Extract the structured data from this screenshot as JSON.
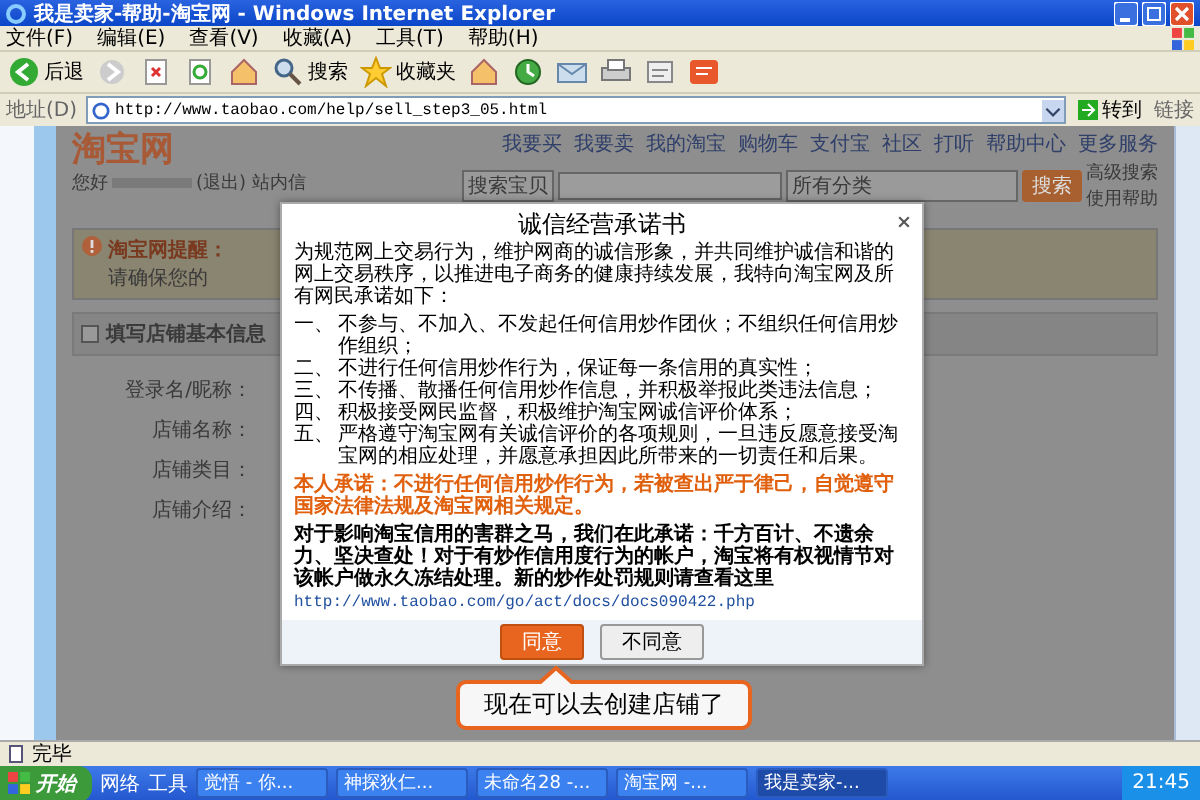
{
  "window": {
    "title": "我是卖家-帮助-淘宝网 - Windows Internet Explorer"
  },
  "menu": [
    "文件(F)",
    "编辑(E)",
    "查看(V)",
    "收藏(A)",
    "工具(T)",
    "帮助(H)"
  ],
  "toolbar": [
    {
      "kind": "back",
      "label": "后退"
    },
    {
      "kind": "forward"
    },
    {
      "kind": "stop"
    },
    {
      "kind": "refresh"
    },
    {
      "kind": "home"
    },
    {
      "kind": "search",
      "label": "搜索"
    },
    {
      "kind": "favorites",
      "label": "收藏夹"
    },
    {
      "kind": "home"
    },
    {
      "kind": "history"
    },
    {
      "kind": "mail"
    },
    {
      "kind": "print"
    },
    {
      "kind": "edit"
    },
    {
      "kind": "blog"
    }
  ],
  "address": {
    "label": "地址(D)",
    "url": "http://www.taobao.com/help/sell_step3_05.html",
    "go": "转到",
    "links": "链接"
  },
  "page": {
    "logo": "淘宝网",
    "greeting_prefix": "您好",
    "greeting_suffix": "(退出) 站内信",
    "nav": [
      "我要买",
      "我要卖",
      "我的淘宝",
      "购物车",
      "支付宝",
      "社区",
      "打听",
      "帮助中心",
      "更多服务"
    ],
    "search": {
      "category": "搜索宝贝",
      "scope": "所有分类",
      "button": "搜索",
      "links": [
        "高级搜索",
        "使用帮助"
      ]
    },
    "notice": {
      "label": "淘宝网提醒：",
      "text": "请确保您的"
    },
    "section_title": "填写店铺基本信息",
    "form_labels": [
      "登录名/昵称：",
      "店铺名称：",
      "店铺类目：",
      "店铺介绍："
    ]
  },
  "dialog": {
    "title": "诚信经营承诺书",
    "intro": "为规范网上交易行为，维护网商的诚信形象，并共同维护诚信和谐的网上交易秩序，以推进电子商务的健康持续发展，我特向淘宝网及所有网民承诺如下：",
    "items": [
      {
        "marker": "一、",
        "text": "不参与、不加入、不发起任何信用炒作团伙；不组织任何信用炒作组织；"
      },
      {
        "marker": "二、",
        "text": "不进行任何信用炒作行为，保证每一条信用的真实性；"
      },
      {
        "marker": "三、",
        "text": "不传播、散播任何信用炒作信息，并积极举报此类违法信息；"
      },
      {
        "marker": "四、",
        "text": "积极接受网民监督，积极维护淘宝网诚信评价体系；"
      },
      {
        "marker": "五、",
        "text": "严格遵守淘宝网有关诚信评价的各项规则，一旦违反愿意接受淘宝网的相应处理，并愿意承担因此所带来的一切责任和后果。"
      }
    ],
    "pledge": "本人承诺：不进行任何信用炒作行为，若被查出严于律己，自觉遵守国家法律法规及淘宝网相关规定。",
    "warning": "对于影响淘宝信用的害群之马，我们在此承诺：千方百计、不遗余力、坚决查处！对于有炒作信用度行为的帐户，淘宝将有权视情节对该帐户做永久冻结处理。新的炒作处罚规则请查看这里",
    "link": "http://www.taobao.com/go/act/docs/docs090422.php",
    "buttons": [
      {
        "label": "同意",
        "primary": true
      },
      {
        "label": "不同意",
        "primary": false
      }
    ]
  },
  "callout": "现在可以去创建店铺了",
  "status_bar": "完毕",
  "taskbar": {
    "start": "开始",
    "quick": [
      "网络",
      "工具"
    ],
    "tasks": [
      {
        "label": "觉悟 - 你...",
        "selected": false
      },
      {
        "label": "神探狄仁...",
        "selected": false
      },
      {
        "label": "未命名28 -...",
        "selected": false
      },
      {
        "label": "淘宝网 -...",
        "selected": false
      },
      {
        "label": "我是卖家-...",
        "selected": true
      }
    ],
    "clock": "21:45"
  }
}
